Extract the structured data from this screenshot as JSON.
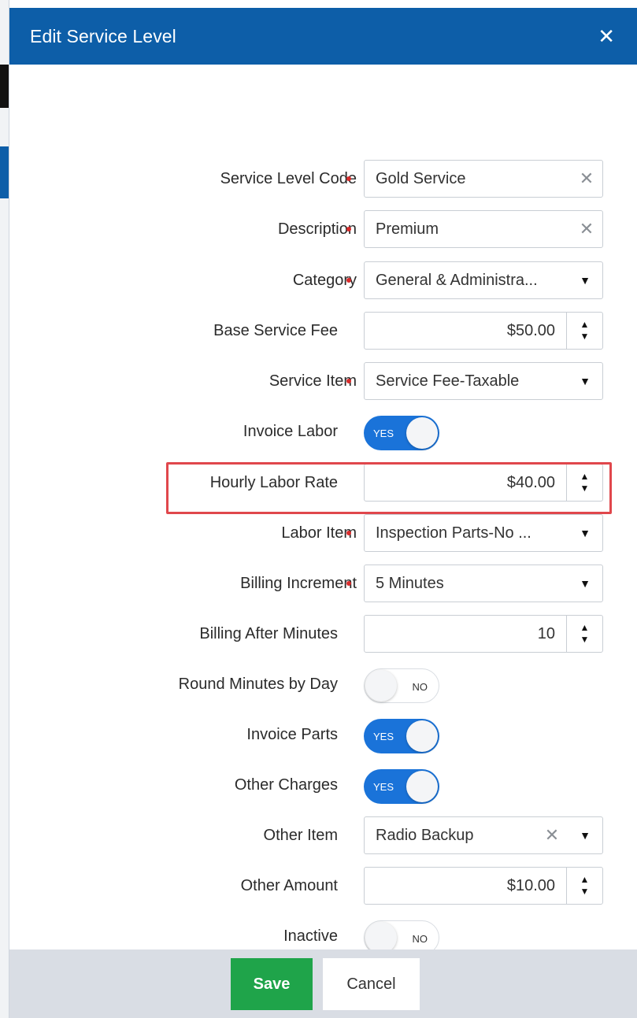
{
  "dialog": {
    "title": "Edit Service Level",
    "close_glyph": "✕"
  },
  "fields": {
    "service_level_code": {
      "label": "Service Level Code",
      "value": "Gold Service"
    },
    "description": {
      "label": "Description",
      "value": "Premium"
    },
    "category": {
      "label": "Category",
      "value": "General & Administra..."
    },
    "base_service_fee": {
      "label": "Base Service Fee",
      "value": "$50.00"
    },
    "service_item": {
      "label": "Service Item",
      "value": "Service Fee-Taxable"
    },
    "invoice_labor": {
      "label": "Invoice Labor",
      "state": "YES"
    },
    "hourly_labor_rate": {
      "label": "Hourly Labor Rate",
      "value": "$40.00"
    },
    "labor_item": {
      "label": "Labor Item",
      "value": "Inspection Parts-No ..."
    },
    "billing_increment": {
      "label": "Billing Increment",
      "value": "5 Minutes"
    },
    "billing_after_minutes": {
      "label": "Billing After Minutes",
      "value": "10"
    },
    "round_minutes_by_day": {
      "label": "Round Minutes by Day",
      "state": "NO"
    },
    "invoice_parts": {
      "label": "Invoice Parts",
      "state": "YES"
    },
    "other_charges": {
      "label": "Other Charges",
      "state": "YES"
    },
    "other_item": {
      "label": "Other Item",
      "value": "Radio Backup"
    },
    "other_amount": {
      "label": "Other Amount",
      "value": "$10.00"
    },
    "inactive": {
      "label": "Inactive",
      "state": "NO"
    }
  },
  "glyphs": {
    "clear": "✕",
    "caret": "▼",
    "spin_up": "▲",
    "spin_down": "▼"
  },
  "footer": {
    "save_label": "Save",
    "cancel_label": "Cancel"
  },
  "colors": {
    "header": "#0d5ea8",
    "toggle_on": "#1a73d9",
    "save": "#1fa44a",
    "required_dot": "#d92b2b",
    "highlight": "#e0474c"
  }
}
